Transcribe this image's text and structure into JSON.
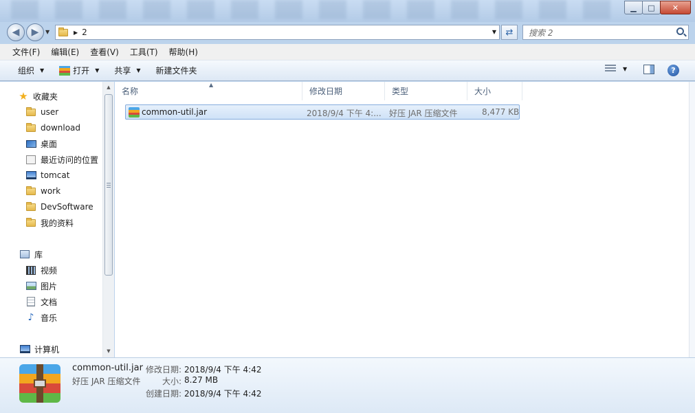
{
  "window": {
    "minimize_glyph": "▁",
    "maximize_glyph": "□",
    "close_glyph": "✕"
  },
  "address": {
    "crumb": "2",
    "search_placeholder": "搜索 2"
  },
  "menu": [
    "文件(F)",
    "编辑(E)",
    "查看(V)",
    "工具(T)",
    "帮助(H)"
  ],
  "toolbar": {
    "organize": "组织",
    "open": "打开",
    "share": "共享",
    "new_folder": "新建文件夹"
  },
  "nav": {
    "favorites": "收藏夹",
    "favorite_items": [
      "user",
      "download",
      "桌面",
      "最近访问的位置",
      "tomcat",
      "work",
      "DevSoftware",
      "我的资料"
    ],
    "libraries": "库",
    "library_items": [
      "视频",
      "图片",
      "文档",
      "音乐"
    ],
    "computer": "计算机"
  },
  "columns": {
    "name": "名称",
    "modified": "修改日期",
    "type": "类型",
    "size": "大小"
  },
  "files": [
    {
      "name": "common-util.jar",
      "modified": "2018/9/4 下午 4:...",
      "type": "好压 JAR 压缩文件",
      "size": "8,477 KB",
      "selected": true
    }
  ],
  "details": {
    "name": "common-util.jar",
    "type": "好压 JAR 压缩文件",
    "modified_label": "修改日期:",
    "modified_value": "2018/9/4 下午 4:42",
    "size_label": "大小:",
    "size_value": "8.27 MB",
    "created_label": "创建日期:",
    "created_value": "2018/9/4 下午 4:42"
  },
  "colors": {
    "accent": "#84acdd",
    "selection": "#cfe2f7",
    "rar_stripes": [
      "#4aa6e8",
      "#f2a61f",
      "#d94a3a",
      "#5fb847"
    ]
  }
}
